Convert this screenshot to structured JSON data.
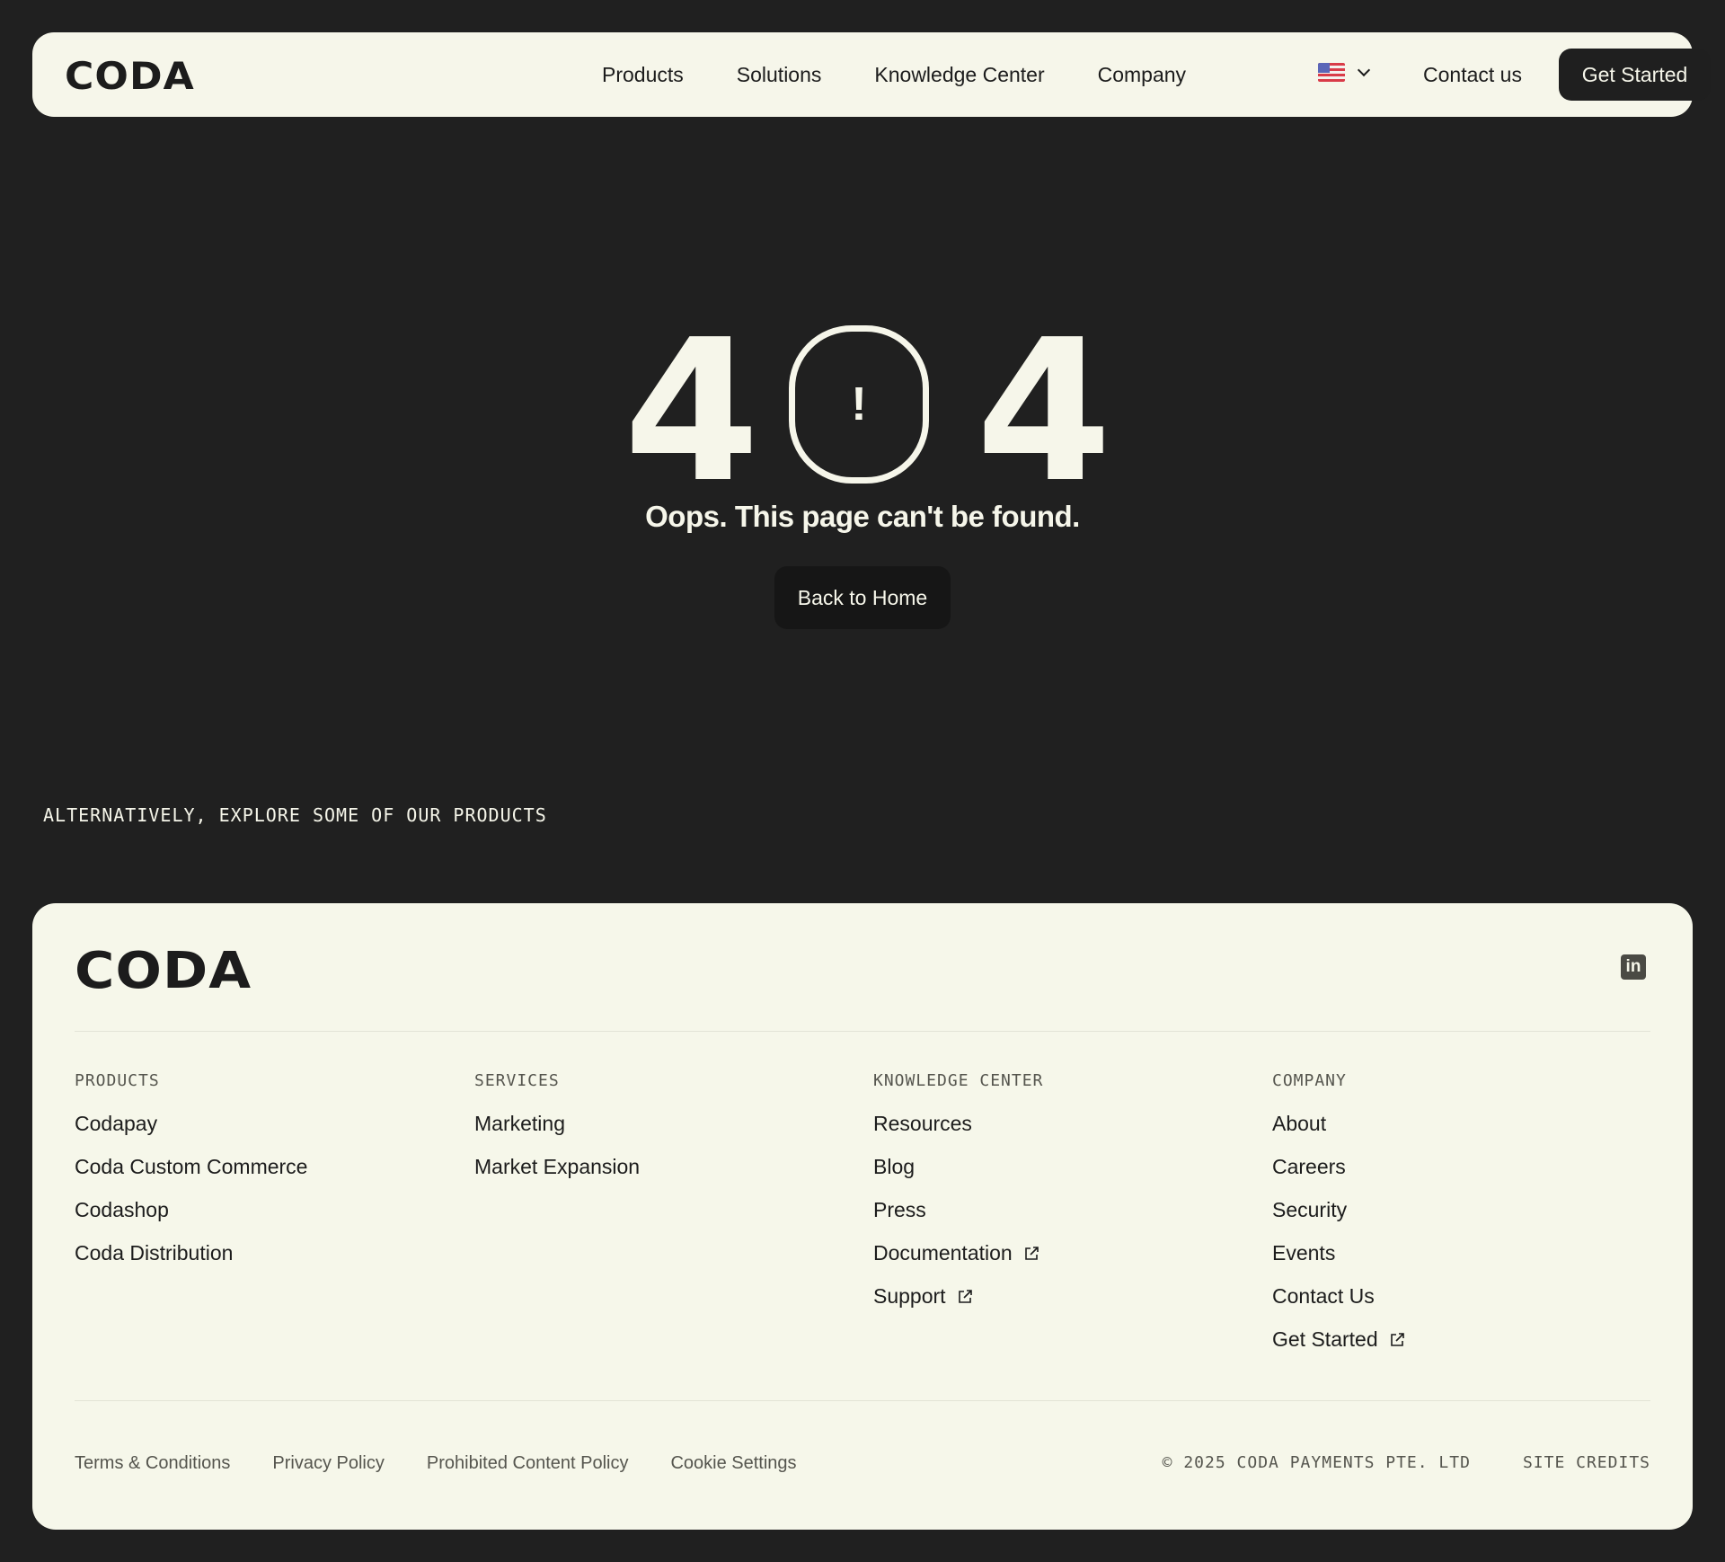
{
  "brand": {
    "logo_text": "CODA"
  },
  "nav": {
    "links": [
      "Products",
      "Solutions",
      "Knowledge Center",
      "Company"
    ],
    "contact": "Contact us",
    "cta": "Get Started",
    "language_icon": "us-flag-icon"
  },
  "hero": {
    "digit_left": "4",
    "zero_symbol": "!",
    "digit_right": "4",
    "message": "Oops. This page can't be found.",
    "button": "Back to Home"
  },
  "explore_label": "ALTERNATIVELY, EXPLORE SOME OF OUR PRODUCTS",
  "footer": {
    "logo_text": "CODA",
    "social_icon": "linkedin-icon",
    "columns": [
      {
        "heading": "PRODUCTS",
        "items": [
          {
            "label": "Codapay",
            "external": false
          },
          {
            "label": "Coda Custom Commerce",
            "external": false
          },
          {
            "label": "Codashop",
            "external": false
          },
          {
            "label": "Coda Distribution",
            "external": false
          }
        ]
      },
      {
        "heading": "SERVICES",
        "items": [
          {
            "label": "Marketing",
            "external": false
          },
          {
            "label": "Market Expansion",
            "external": false
          }
        ]
      },
      {
        "heading": "KNOWLEDGE CENTER",
        "items": [
          {
            "label": "Resources",
            "external": false
          },
          {
            "label": "Blog",
            "external": false
          },
          {
            "label": "Press",
            "external": false
          },
          {
            "label": "Documentation",
            "external": true
          },
          {
            "label": "Support",
            "external": true
          }
        ]
      },
      {
        "heading": "COMPANY",
        "items": [
          {
            "label": "About",
            "external": false
          },
          {
            "label": "Careers",
            "external": false
          },
          {
            "label": "Security",
            "external": false
          },
          {
            "label": "Events",
            "external": false
          },
          {
            "label": "Contact Us",
            "external": false
          },
          {
            "label": "Get Started",
            "external": true
          }
        ]
      }
    ],
    "legal": [
      "Terms & Conditions",
      "Privacy Policy",
      "Prohibited Content Policy",
      "Cookie Settings"
    ],
    "copyright": "© 2025 CODA PAYMENTS PTE. LTD",
    "credits": "SITE CREDITS"
  }
}
